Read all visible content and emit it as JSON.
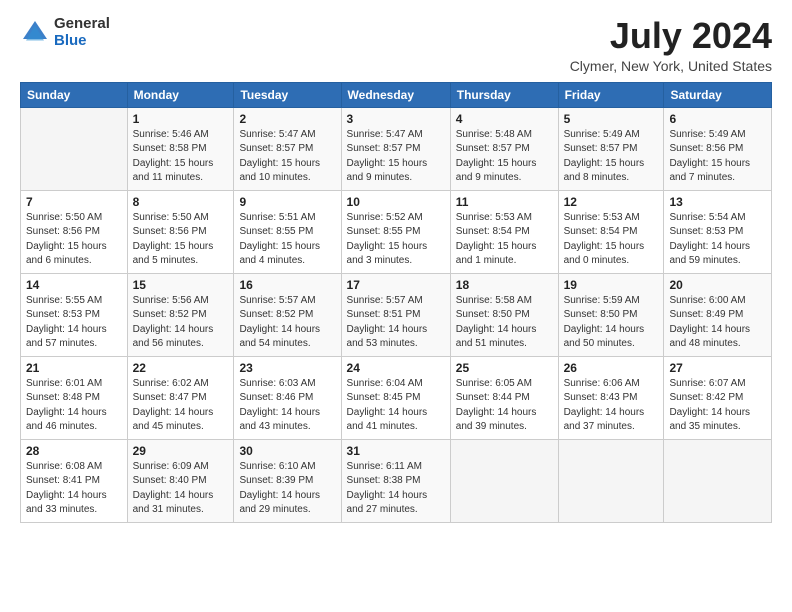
{
  "header": {
    "logo_general": "General",
    "logo_blue": "Blue",
    "title": "July 2024",
    "subtitle": "Clymer, New York, United States"
  },
  "calendar": {
    "days_of_week": [
      "Sunday",
      "Monday",
      "Tuesday",
      "Wednesday",
      "Thursday",
      "Friday",
      "Saturday"
    ],
    "weeks": [
      [
        {
          "day": "",
          "info": ""
        },
        {
          "day": "1",
          "info": "Sunrise: 5:46 AM\nSunset: 8:58 PM\nDaylight: 15 hours\nand 11 minutes."
        },
        {
          "day": "2",
          "info": "Sunrise: 5:47 AM\nSunset: 8:57 PM\nDaylight: 15 hours\nand 10 minutes."
        },
        {
          "day": "3",
          "info": "Sunrise: 5:47 AM\nSunset: 8:57 PM\nDaylight: 15 hours\nand 9 minutes."
        },
        {
          "day": "4",
          "info": "Sunrise: 5:48 AM\nSunset: 8:57 PM\nDaylight: 15 hours\nand 9 minutes."
        },
        {
          "day": "5",
          "info": "Sunrise: 5:49 AM\nSunset: 8:57 PM\nDaylight: 15 hours\nand 8 minutes."
        },
        {
          "day": "6",
          "info": "Sunrise: 5:49 AM\nSunset: 8:56 PM\nDaylight: 15 hours\nand 7 minutes."
        }
      ],
      [
        {
          "day": "7",
          "info": "Sunrise: 5:50 AM\nSunset: 8:56 PM\nDaylight: 15 hours\nand 6 minutes."
        },
        {
          "day": "8",
          "info": "Sunrise: 5:50 AM\nSunset: 8:56 PM\nDaylight: 15 hours\nand 5 minutes."
        },
        {
          "day": "9",
          "info": "Sunrise: 5:51 AM\nSunset: 8:55 PM\nDaylight: 15 hours\nand 4 minutes."
        },
        {
          "day": "10",
          "info": "Sunrise: 5:52 AM\nSunset: 8:55 PM\nDaylight: 15 hours\nand 3 minutes."
        },
        {
          "day": "11",
          "info": "Sunrise: 5:53 AM\nSunset: 8:54 PM\nDaylight: 15 hours\nand 1 minute."
        },
        {
          "day": "12",
          "info": "Sunrise: 5:53 AM\nSunset: 8:54 PM\nDaylight: 15 hours\nand 0 minutes."
        },
        {
          "day": "13",
          "info": "Sunrise: 5:54 AM\nSunset: 8:53 PM\nDaylight: 14 hours\nand 59 minutes."
        }
      ],
      [
        {
          "day": "14",
          "info": "Sunrise: 5:55 AM\nSunset: 8:53 PM\nDaylight: 14 hours\nand 57 minutes."
        },
        {
          "day": "15",
          "info": "Sunrise: 5:56 AM\nSunset: 8:52 PM\nDaylight: 14 hours\nand 56 minutes."
        },
        {
          "day": "16",
          "info": "Sunrise: 5:57 AM\nSunset: 8:52 PM\nDaylight: 14 hours\nand 54 minutes."
        },
        {
          "day": "17",
          "info": "Sunrise: 5:57 AM\nSunset: 8:51 PM\nDaylight: 14 hours\nand 53 minutes."
        },
        {
          "day": "18",
          "info": "Sunrise: 5:58 AM\nSunset: 8:50 PM\nDaylight: 14 hours\nand 51 minutes."
        },
        {
          "day": "19",
          "info": "Sunrise: 5:59 AM\nSunset: 8:50 PM\nDaylight: 14 hours\nand 50 minutes."
        },
        {
          "day": "20",
          "info": "Sunrise: 6:00 AM\nSunset: 8:49 PM\nDaylight: 14 hours\nand 48 minutes."
        }
      ],
      [
        {
          "day": "21",
          "info": "Sunrise: 6:01 AM\nSunset: 8:48 PM\nDaylight: 14 hours\nand 46 minutes."
        },
        {
          "day": "22",
          "info": "Sunrise: 6:02 AM\nSunset: 8:47 PM\nDaylight: 14 hours\nand 45 minutes."
        },
        {
          "day": "23",
          "info": "Sunrise: 6:03 AM\nSunset: 8:46 PM\nDaylight: 14 hours\nand 43 minutes."
        },
        {
          "day": "24",
          "info": "Sunrise: 6:04 AM\nSunset: 8:45 PM\nDaylight: 14 hours\nand 41 minutes."
        },
        {
          "day": "25",
          "info": "Sunrise: 6:05 AM\nSunset: 8:44 PM\nDaylight: 14 hours\nand 39 minutes."
        },
        {
          "day": "26",
          "info": "Sunrise: 6:06 AM\nSunset: 8:43 PM\nDaylight: 14 hours\nand 37 minutes."
        },
        {
          "day": "27",
          "info": "Sunrise: 6:07 AM\nSunset: 8:42 PM\nDaylight: 14 hours\nand 35 minutes."
        }
      ],
      [
        {
          "day": "28",
          "info": "Sunrise: 6:08 AM\nSunset: 8:41 PM\nDaylight: 14 hours\nand 33 minutes."
        },
        {
          "day": "29",
          "info": "Sunrise: 6:09 AM\nSunset: 8:40 PM\nDaylight: 14 hours\nand 31 minutes."
        },
        {
          "day": "30",
          "info": "Sunrise: 6:10 AM\nSunset: 8:39 PM\nDaylight: 14 hours\nand 29 minutes."
        },
        {
          "day": "31",
          "info": "Sunrise: 6:11 AM\nSunset: 8:38 PM\nDaylight: 14 hours\nand 27 minutes."
        },
        {
          "day": "",
          "info": ""
        },
        {
          "day": "",
          "info": ""
        },
        {
          "day": "",
          "info": ""
        }
      ]
    ]
  }
}
